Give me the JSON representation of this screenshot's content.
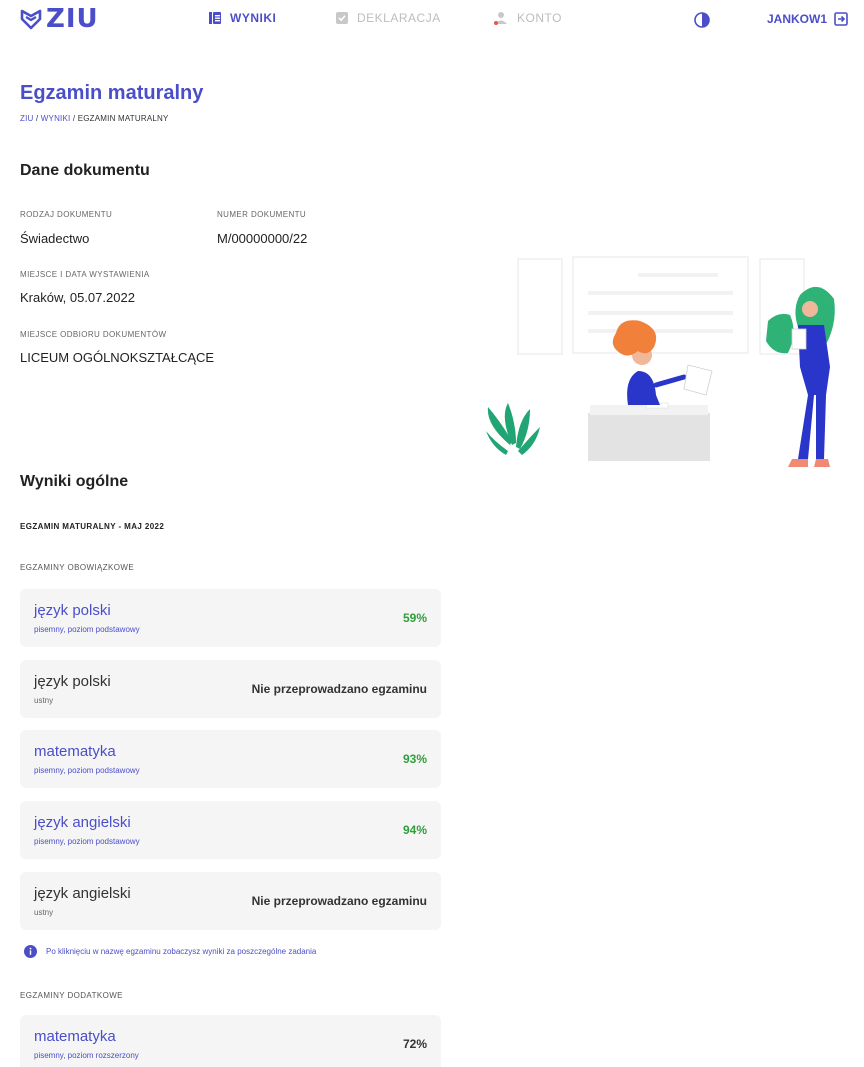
{
  "brand": {
    "logo": "ZIU",
    "accent": "#4b4ec9",
    "success": "#2f9e3a"
  },
  "nav": {
    "items": [
      {
        "label": "WYNIKI",
        "icon": "list-icon",
        "active": true
      },
      {
        "label": "DEKLARACJA",
        "icon": "clipboard-icon",
        "active": false
      },
      {
        "label": "KONTO",
        "icon": "user-icon",
        "active": false
      }
    ],
    "contrast_icon": "contrast-icon",
    "username": "JANKOW1",
    "logout_icon": "logout-icon"
  },
  "header": {
    "title": "Egzamin maturalny",
    "breadcrumb": [
      "ZIU",
      "WYNIKI",
      "EGZAMIN MATURALNY"
    ],
    "breadcrumb_sep": " / "
  },
  "document": {
    "section_title": "Dane dokumentu",
    "fields": {
      "type_label": "RODZAJ DOKUMENTU",
      "type_value": "Świadectwo",
      "number_label": "NUMER DOKUMENTU",
      "number_value": "M/00000000/22",
      "place_date_label": "MIEJSCE I DATA WYSTAWIENIA",
      "place_date_value": "Kraków, 05.07.2022",
      "pickup_label": "MIEJSCE ODBIORU DOKUMENTÓW",
      "pickup_value": "LICEUM OGÓLNOKSZTAŁCĄCE"
    }
  },
  "results": {
    "section_title": "Wyniki ogólne",
    "session": "EGZAMIN MATURALNY - MAJ 2022",
    "mandatory_label": "EGZAMINY OBOWIĄZKOWE",
    "mandatory": [
      {
        "name": "język polski",
        "detail": "pisemny, poziom podstawowy",
        "result": "59%"
      },
      {
        "name": "język polski",
        "detail": "ustny",
        "result": "Nie przeprowadzano egzaminu"
      },
      {
        "name": "matematyka",
        "detail": "pisemny, poziom podstawowy",
        "result": "93%"
      },
      {
        "name": "język angielski",
        "detail": "pisemny, poziom podstawowy",
        "result": "94%"
      },
      {
        "name": "język angielski",
        "detail": "ustny",
        "result": "Nie przeprowadzano egzaminu"
      }
    ],
    "info_note": "Po kliknięciu w nazwę egzaminu zobaczysz wyniki za poszczególne zadania",
    "additional_label": "EGZAMINY DODATKOWE",
    "additional": [
      {
        "name": "matematyka",
        "detail": "pisemny, poziom rozszerzony",
        "result": "72%"
      }
    ]
  }
}
